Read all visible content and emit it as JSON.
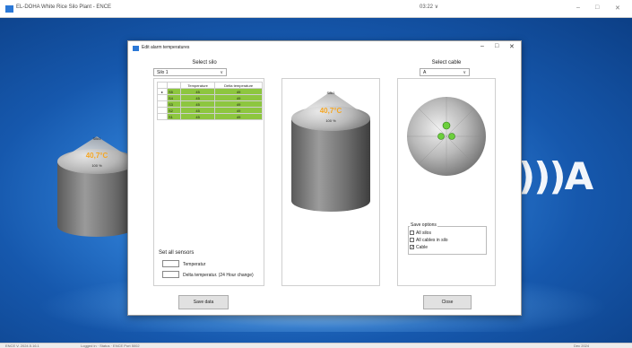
{
  "app": {
    "title": "EL-DOHA White Rice Silo Plant - ENCE",
    "clock": "03:22 ∨",
    "minimize": "–",
    "maximize": "□",
    "close": "✕"
  },
  "background_silo": {
    "name": "Silo1",
    "temp": "40,7°C",
    "percent": "100 %"
  },
  "brand_text": ")))A",
  "statusbar": {
    "left": "ENCE V. 2024.5.16.1",
    "center": "Logged in  ·  Status  ·  ENCE Port 5002",
    "right": "Dec 2024"
  },
  "dialog": {
    "title": "Edit alarm temperatures",
    "minimize": "–",
    "maximize": "□",
    "close": "✕",
    "select_silo_label": "Select silo",
    "select_silo_value": "Silo 1",
    "select_cable_label": "Select cable",
    "select_cable_value": "A",
    "table": {
      "headers": [
        "Temperature",
        "Delta temperature"
      ],
      "rows": [
        {
          "id": "S5",
          "temp": "45",
          "delta": "49"
        },
        {
          "id": "S4",
          "temp": "45",
          "delta": "49"
        },
        {
          "id": "S3",
          "temp": "45",
          "delta": "49"
        },
        {
          "id": "S2",
          "temp": "45",
          "delta": "49"
        },
        {
          "id": "S1",
          "temp": "45",
          "delta": "49"
        }
      ]
    },
    "set_all_title": "Set all sensors",
    "temp_label": "Temperatur",
    "delta_label": "Delta temperatur. (24 Hour change)",
    "preview_silo": {
      "name": "Silo1",
      "temp": "40,7°C",
      "percent": "100 %"
    },
    "save_options_title": "Save options",
    "save_options": [
      {
        "label": "All silos",
        "checked": false
      },
      {
        "label": "All cables in silo",
        "checked": false
      },
      {
        "label": "Cable",
        "checked": true
      }
    ],
    "save_button": "Save data",
    "close_button": "Close"
  },
  "colors": {
    "sensor_green": "#8dc63f",
    "temp_orange": "#f5a623",
    "desktop_blue": "#1a5fb0"
  }
}
